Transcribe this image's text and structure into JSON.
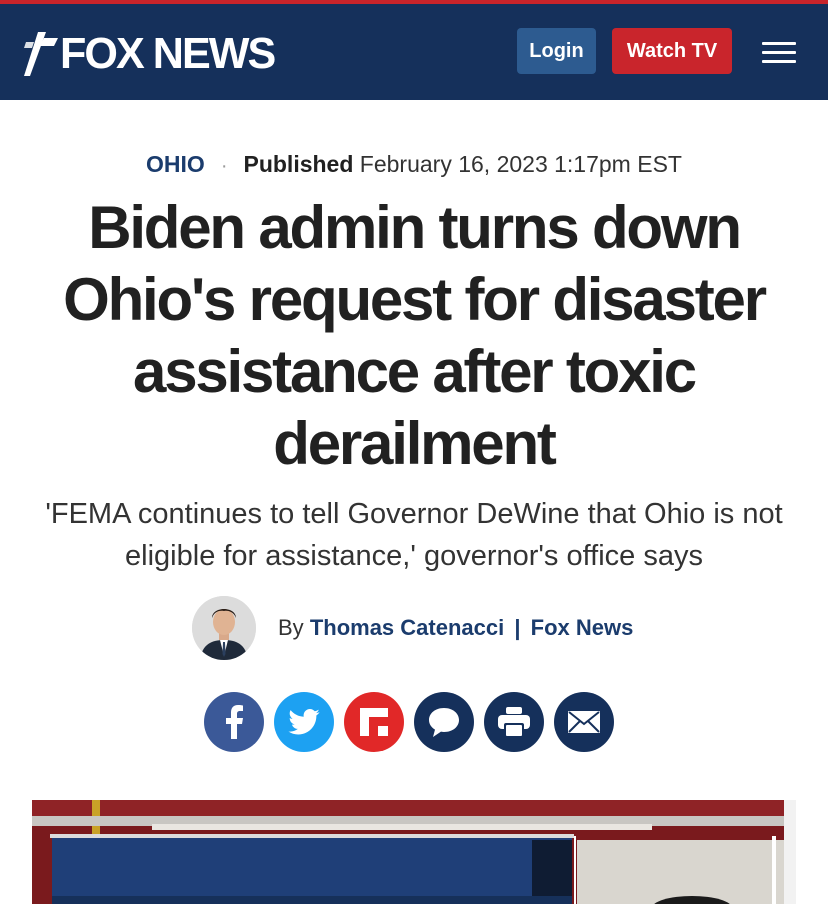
{
  "header": {
    "logo_text": "FOX NEWS",
    "login_label": "Login",
    "watch_label": "Watch TV"
  },
  "article": {
    "category": "OHIO",
    "published_label": "Published",
    "date": "February 16, 2023 1:17pm EST",
    "headline": "Biden admin turns down Ohio's request for disaster assistance after toxic derailment",
    "subhead": "'FEMA continues to tell Governor DeWine that Ohio is not eligible for assistance,' governor's office says",
    "by_label": "By",
    "author": "Thomas Catenacci",
    "author_sep": "|",
    "author_org": "Fox News"
  },
  "share_buttons": [
    {
      "name": "facebook-icon",
      "color": "#3b5998"
    },
    {
      "name": "twitter-icon",
      "color": "#1da1f2"
    },
    {
      "name": "flipboard-icon",
      "color": "#e12828"
    },
    {
      "name": "comments-icon",
      "color": "#15305b"
    },
    {
      "name": "print-icon",
      "color": "#15305b"
    },
    {
      "name": "email-icon",
      "color": "#15305b"
    }
  ],
  "colors": {
    "brand_navy": "#15305b",
    "accent_red": "#c9252c",
    "link_blue": "#1b3c6d"
  }
}
